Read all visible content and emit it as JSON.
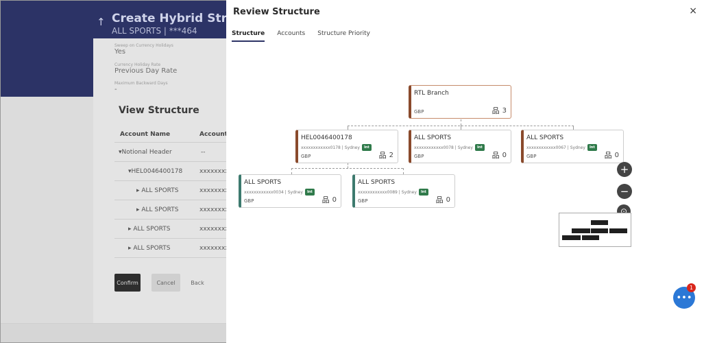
{
  "background": {
    "title": "Create Hybrid Structure",
    "subtitle": "ALL SPORTS | ***464",
    "fields": [
      {
        "label": "Sweep on Currency Holidays",
        "value": "Yes"
      },
      {
        "label": "Currency Holiday Rate",
        "value": "Previous Day Rate"
      },
      {
        "label": "Maximum Backward Days",
        "value": "-"
      }
    ],
    "view_structure_title": "View Structure",
    "table_headers": [
      "Account Name",
      "Account N"
    ],
    "rows": [
      {
        "name": "Notional Header",
        "acc": "--"
      },
      {
        "name": "HEL0046400178",
        "acc": "xxxxxxxxx"
      },
      {
        "name": "ALL SPORTS",
        "acc": "xxxxxxxxx"
      },
      {
        "name": "ALL SPORTS",
        "acc": "xxxxxxxxx"
      },
      {
        "name": "ALL SPORTS",
        "acc": "xxxxxxxxx"
      },
      {
        "name": "ALL SPORTS",
        "acc": "xxxxxxxxx"
      }
    ],
    "buttons": {
      "confirm": "Confirm",
      "cancel": "Cancel",
      "back": "Back"
    }
  },
  "modal": {
    "title": "Review Structure",
    "close": "×",
    "tabs": [
      "Structure",
      "Accounts",
      "Structure Priority"
    ],
    "nodes": {
      "root": {
        "name": "RTL Branch",
        "ccy": "GBP",
        "children": "3"
      },
      "l1": [
        {
          "name": "HEL0046400178",
          "acc": "xxxxxxxxxxxx0178 | Sydney",
          "badge": "Int",
          "ccy": "GBP",
          "children": "2"
        },
        {
          "name": "ALL SPORTS",
          "acc": "xxxxxxxxxxxx0078 | Sydney",
          "badge": "Int",
          "ccy": "GBP",
          "children": "0"
        },
        {
          "name": "ALL SPORTS",
          "acc": "xxxxxxxxxxxx0067 | Sydney",
          "badge": "Int",
          "ccy": "GBP",
          "children": "0"
        }
      ],
      "l2": [
        {
          "name": "ALL SPORTS",
          "acc": "xxxxxxxxxxxx0034 | Sydney",
          "badge": "Int",
          "ccy": "GBP",
          "children": "0"
        },
        {
          "name": "ALL SPORTS",
          "acc": "xxxxxxxxxxxx0089 | Sydney",
          "badge": "Int",
          "ccy": "GBP",
          "children": "0"
        }
      ]
    },
    "zoom": {
      "in": "+",
      "out": "−",
      "reset": "⊙"
    },
    "chat_badge": "1"
  },
  "colors": {
    "accent": "#2c3366",
    "node_border": "#8a4a2c",
    "leaf_border": "#3d7a6e",
    "badge": "#2f7a4a"
  },
  "icons": {
    "hierarchy": "hierarchy-icon",
    "chat": "chat-icon",
    "close": "close-icon",
    "back": "back-arrow-icon"
  }
}
